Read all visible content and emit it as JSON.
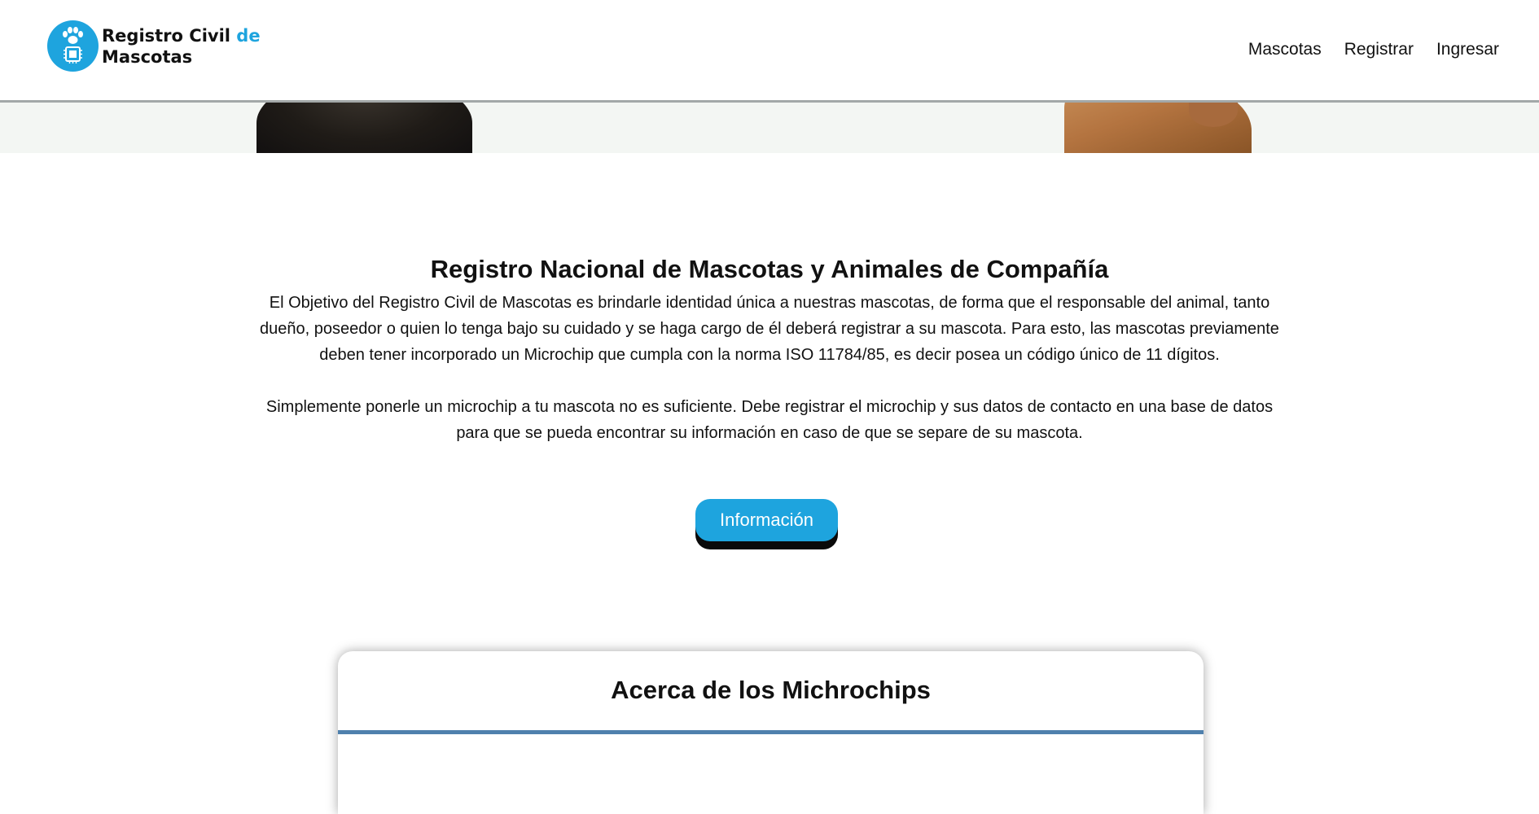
{
  "header": {
    "logo": {
      "line1": "Registro Civil",
      "accent": "de",
      "line2": "Mascotas",
      "icon": "paw-microchip-icon"
    },
    "nav": [
      {
        "label": "Mascotas"
      },
      {
        "label": "Registrar"
      },
      {
        "label": "Ingresar"
      }
    ]
  },
  "main": {
    "title": "Registro Nacional de Mascotas y Animales de Compañía",
    "paragraph1": "El Objetivo del Registro Civil de Mascotas es brindarle identidad única a nuestras mascotas, de forma que el responsable del animal, tanto dueño, poseedor o quien lo tenga bajo su cuidado y se haga cargo de él deberá registrar a su mascota. Para esto, las mascotas previamente deben tener incorporado un Microchip que cumpla con la norma ISO 11784/85, es decir posea un código único de 11 dígitos.",
    "paragraph2": "Simplemente ponerle un microchip a tu mascota no es suficiente. Debe registrar el microchip y sus datos de contacto en una base de datos para que se pueda encontrar su información en caso de que se separe de su mascota.",
    "button_label": "Información"
  },
  "card": {
    "title": "Acerca de los Michrochips"
  },
  "colors": {
    "accent": "#1ea4de",
    "card_rule": "#4f80ad",
    "header_border": "#a3a8a8"
  }
}
